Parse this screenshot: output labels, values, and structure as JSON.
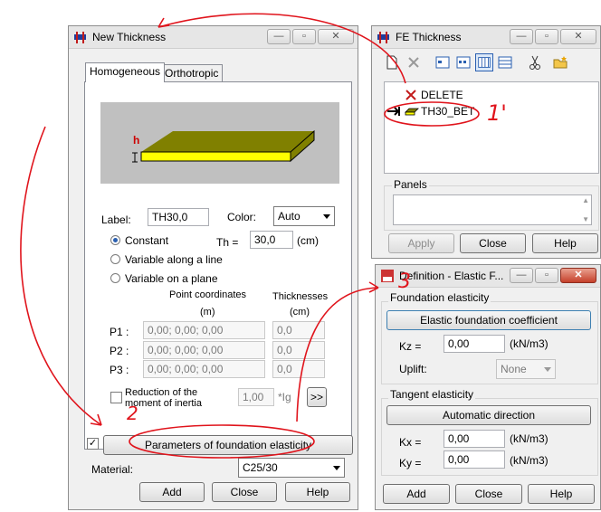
{
  "new_thickness": {
    "title": "New Thickness",
    "tabs": [
      "Homogeneous",
      "Orthotropic"
    ],
    "preview_h": "h",
    "label_caption": "Label:",
    "label_value": "TH30,0",
    "color_caption": "Color:",
    "color_value": "Auto",
    "radio_constant": "Constant",
    "radio_variable_line": "Variable along a line",
    "radio_variable_plane": "Variable on a plane",
    "th_caption": "Th =",
    "th_value": "30,0",
    "th_unit": "(cm)",
    "point_coords_header": "Point coordinates",
    "point_coords_unit": "(m)",
    "thicknesses_header": "Thicknesses",
    "thicknesses_unit": "(cm)",
    "points": [
      {
        "label": "P1 :",
        "coords": "0,00; 0,00; 0,00",
        "thickness": "0,0"
      },
      {
        "label": "P2 :",
        "coords": "0,00; 0,00; 0,00",
        "thickness": "0,0"
      },
      {
        "label": "P3 :",
        "coords": "0,00; 0,00; 0,00",
        "thickness": "0,0"
      }
    ],
    "reduction_line1": "Reduction of the",
    "reduction_line2": "moment of inertia",
    "reduction_value": "1,00",
    "reduction_unit": "*Ig",
    "reduction_button": ">>",
    "foundation_button": "Parameters of foundation elasticity",
    "material_caption": "Material:",
    "material_value": "C25/30",
    "add": "Add",
    "close": "Close",
    "help": "Help"
  },
  "fe_thickness": {
    "title": "FE Thickness",
    "list": [
      {
        "label": "DELETE",
        "icon": "delete-x-icon"
      },
      {
        "label": "TH30_BET",
        "icon": "slab-icon"
      }
    ],
    "panels_caption": "Panels",
    "apply": "Apply",
    "close": "Close",
    "help": "Help"
  },
  "definition": {
    "title": "Definition - Elastic F...",
    "foundation_group": "Foundation elasticity",
    "elastic_button": "Elastic foundation coefficient",
    "kz_caption": "Kz =",
    "kz_value": "0,00",
    "kz_unit": "(kN/m3)",
    "uplift_caption": "Uplift:",
    "uplift_value": "None",
    "tangent_group": "Tangent elasticity",
    "automatic_button": "Automatic direction",
    "kx_caption": "Kx =",
    "kx_value": "0,00",
    "kx_unit": "(kN/m3)",
    "ky_caption": "Ky =",
    "ky_value": "0,00",
    "ky_unit": "(kN/m3)",
    "add": "Add",
    "close": "Close",
    "help": "Help"
  },
  "annotations": [
    "1'",
    "2",
    "3"
  ],
  "colors": {
    "annotation": "#e0141c",
    "slab_top": "#808000",
    "slab_side": "#ffff00",
    "highlight": "#2a5fb0"
  }
}
